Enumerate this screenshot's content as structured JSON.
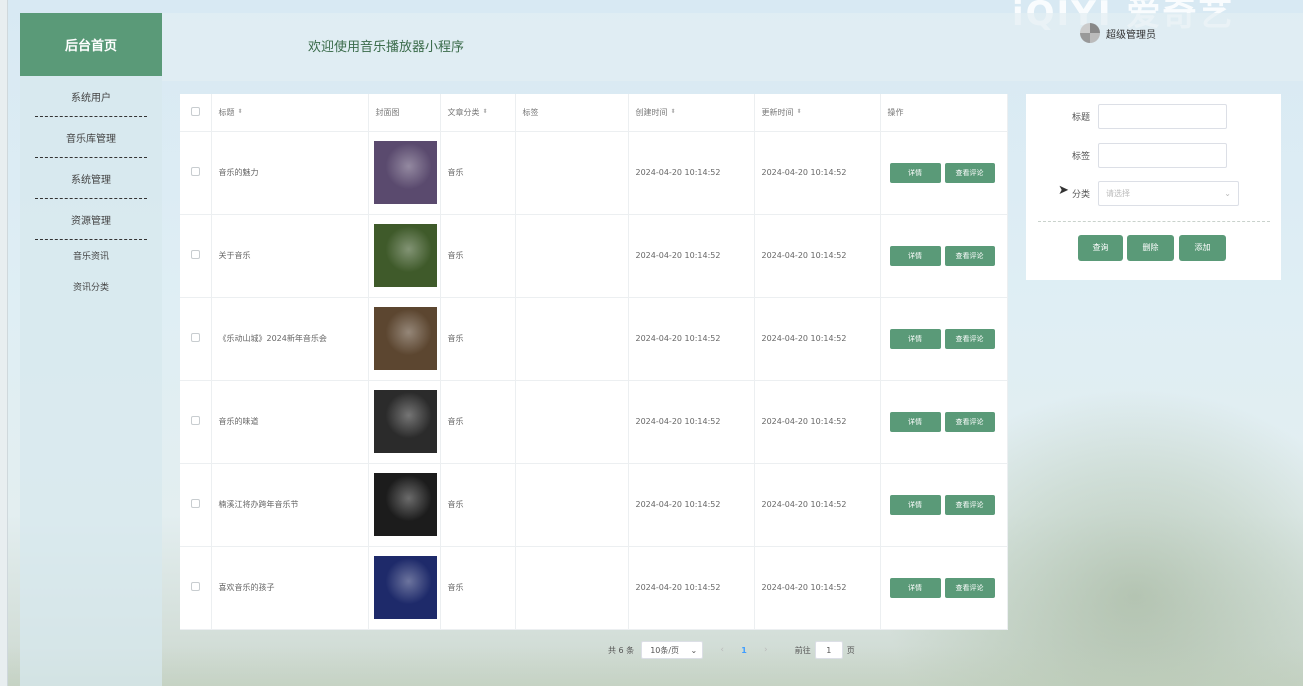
{
  "watermark": "iQIYI 爱奇艺",
  "sidebar": {
    "brand": "后台首页",
    "menu": [
      "系统用户",
      "音乐库管理",
      "系统管理",
      "资源管理"
    ],
    "submenu": [
      "音乐资讯",
      "资讯分类"
    ]
  },
  "header": {
    "title": "欢迎使用音乐播放器小程序",
    "user": "超级管理员"
  },
  "table": {
    "columns": {
      "title": "标题",
      "cover": "封面图",
      "category": "文章分类",
      "tags": "标签",
      "created": "创建时间",
      "updated": "更新时间",
      "ops": "操作"
    },
    "sort_icon": "⬍",
    "rows": [
      {
        "title": "音乐的魅力",
        "category": "音乐",
        "tags": "",
        "created": "2024-04-20 10:14:52",
        "updated": "2024-04-20 10:14:52",
        "cover_color": "#5a4a6e"
      },
      {
        "title": "关于音乐",
        "category": "音乐",
        "tags": "",
        "created": "2024-04-20 10:14:52",
        "updated": "2024-04-20 10:14:52",
        "cover_color": "#3f5a2a"
      },
      {
        "title": "《乐动山城》2024新年音乐会",
        "category": "音乐",
        "tags": "",
        "created": "2024-04-20 10:14:52",
        "updated": "2024-04-20 10:14:52",
        "cover_color": "#5c4630"
      },
      {
        "title": "音乐的味道",
        "category": "音乐",
        "tags": "",
        "created": "2024-04-20 10:14:52",
        "updated": "2024-04-20 10:14:52",
        "cover_color": "#2b2b2b"
      },
      {
        "title": "楠溪江将办跨年音乐节",
        "category": "音乐",
        "tags": "",
        "created": "2024-04-20 10:14:52",
        "updated": "2024-04-20 10:14:52",
        "cover_color": "#1c1c1c"
      },
      {
        "title": "喜欢音乐的孩子",
        "category": "音乐",
        "tags": "",
        "created": "2024-04-20 10:14:52",
        "updated": "2024-04-20 10:14:52",
        "cover_color": "#1e2a6a"
      }
    ],
    "detail_label": "详情",
    "comment_label": "查看评论"
  },
  "pagination": {
    "total": "共 6 条",
    "page_size": "10条/页",
    "prev": "‹",
    "current": "1",
    "next": "›",
    "goto_prefix": "前往",
    "goto_value": "1",
    "goto_suffix": "页"
  },
  "filter": {
    "title_label": "标题",
    "tag_label": "标签",
    "category_label": "分类",
    "category_placeholder": "请选择",
    "search_label": "查询",
    "delete_label": "删除",
    "add_label": "添加"
  },
  "colors": {
    "accent": "#5a9a78"
  }
}
